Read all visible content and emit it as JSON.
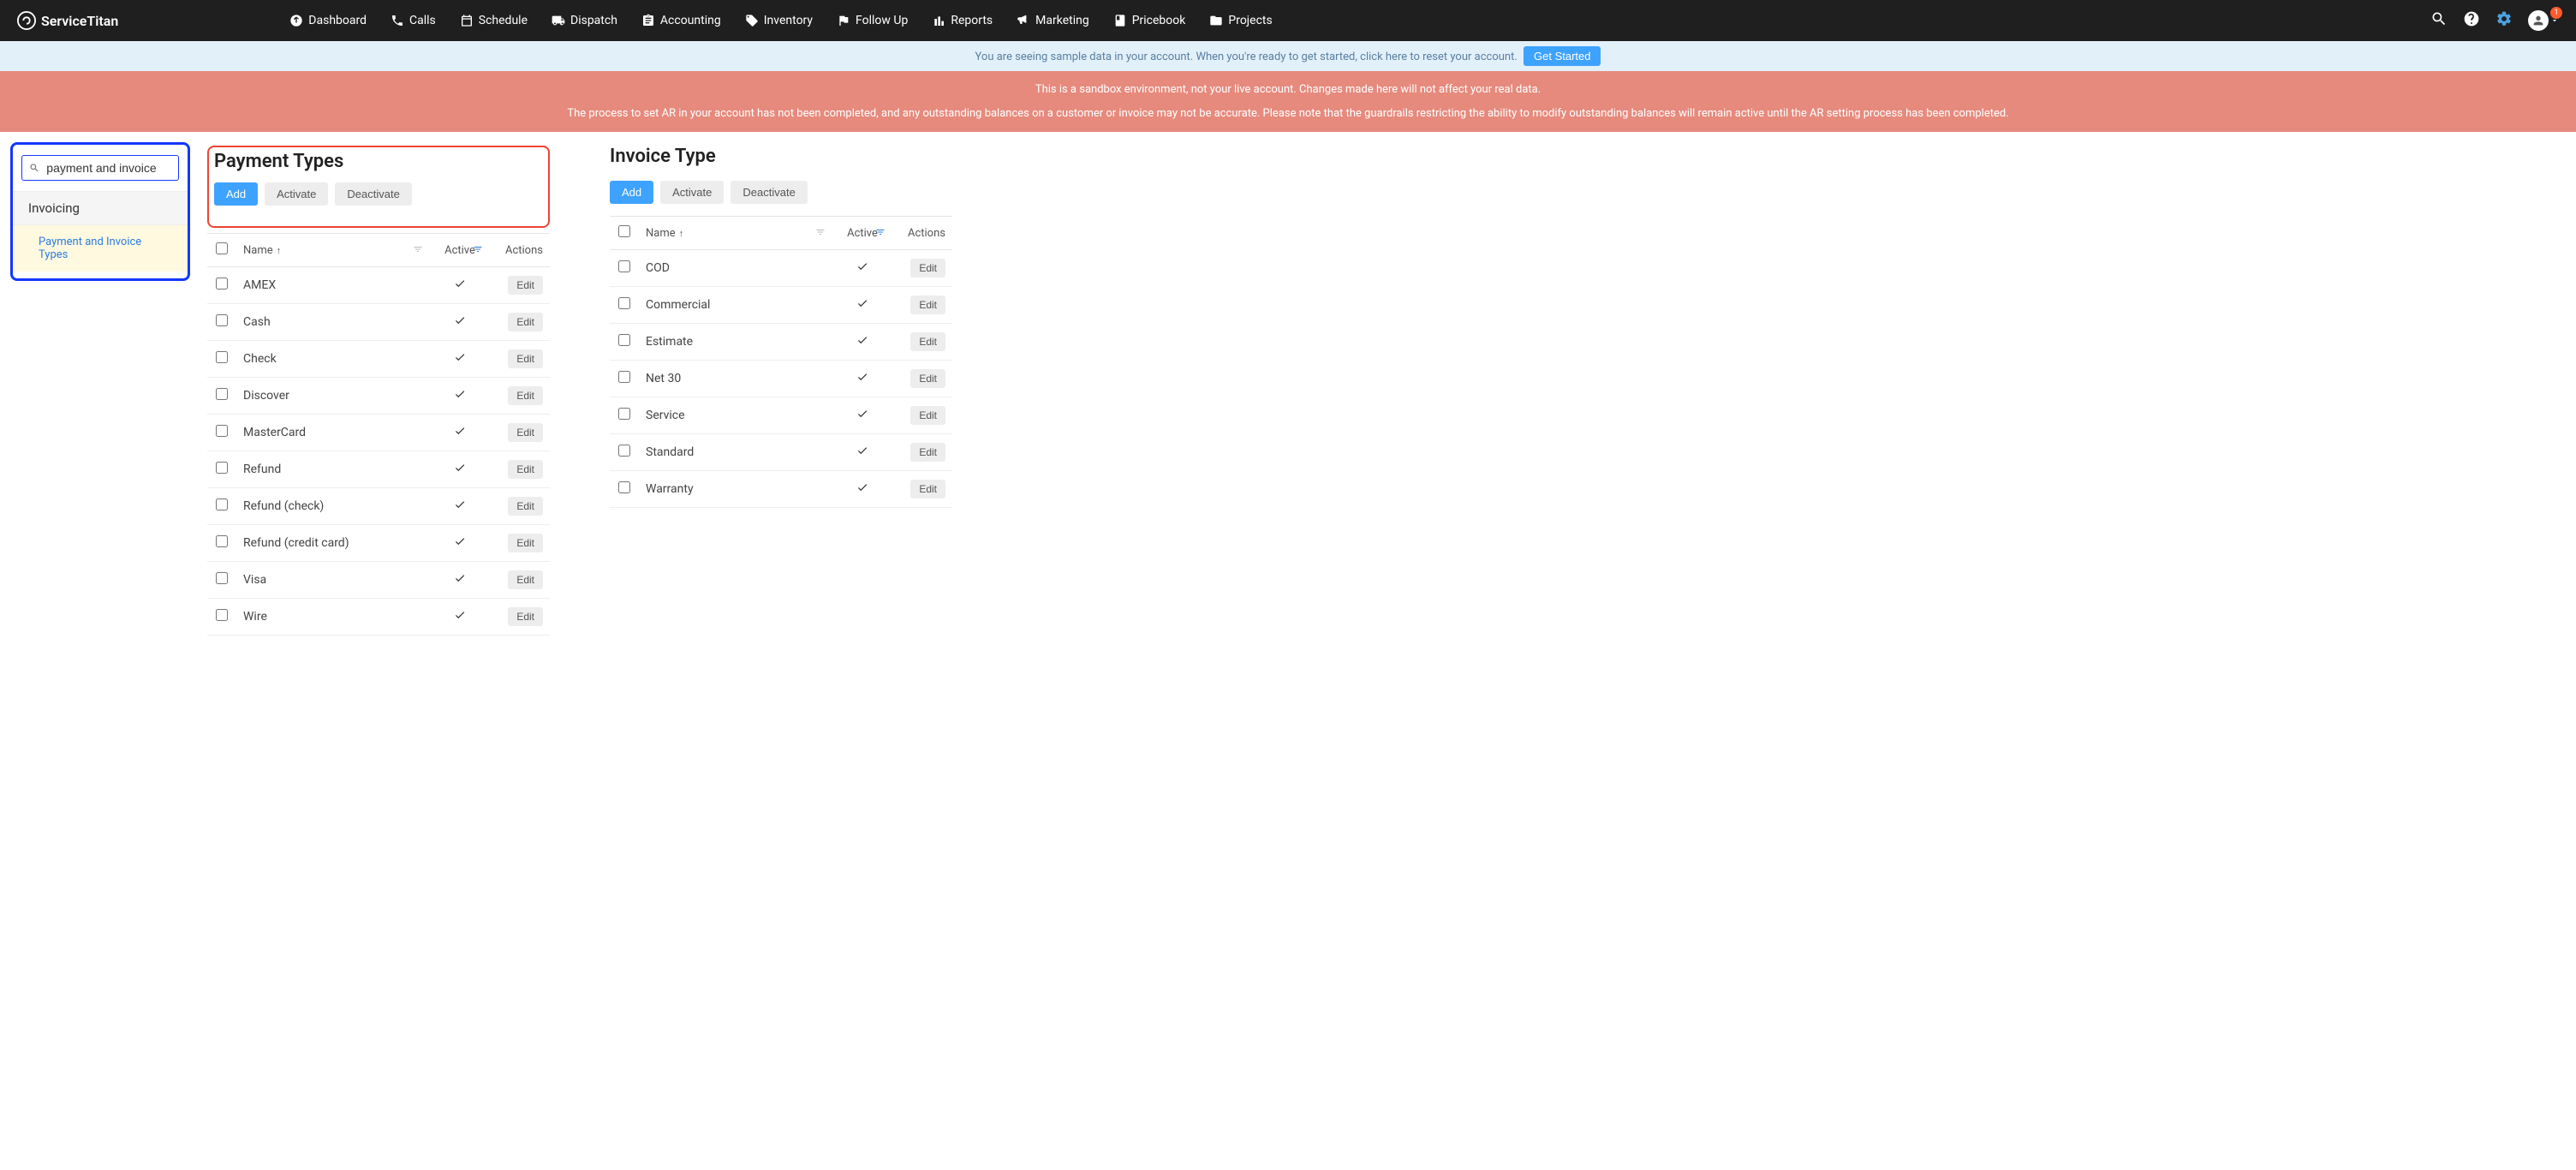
{
  "brand": "ServiceTitan",
  "nav": [
    {
      "label": "Dashboard",
      "icon": "dashboard"
    },
    {
      "label": "Calls",
      "icon": "phone"
    },
    {
      "label": "Schedule",
      "icon": "calendar"
    },
    {
      "label": "Dispatch",
      "icon": "truck"
    },
    {
      "label": "Accounting",
      "icon": "clipboard"
    },
    {
      "label": "Inventory",
      "icon": "tag"
    },
    {
      "label": "Follow Up",
      "icon": "flag"
    },
    {
      "label": "Reports",
      "icon": "bar"
    },
    {
      "label": "Marketing",
      "icon": "megaphone"
    },
    {
      "label": "Pricebook",
      "icon": "book"
    },
    {
      "label": "Projects",
      "icon": "folder"
    }
  ],
  "notification_count": "1",
  "banner_blue": {
    "text": "You are seeing sample data in your account. When you're ready to get started, click here to reset your account.",
    "button": "Get Started"
  },
  "banner_red": {
    "line1": "This is a sandbox environment, not your live account. Changes made here will not affect your real data.",
    "line2": "The process to set AR in your account has not been completed, and any outstanding balances on a customer or invoice may not be accurate. Please note that the guardrails restricting the ability to modify outstanding balances will remain active until the AR setting process has been completed."
  },
  "sidebar": {
    "search_value": "payment and invoice",
    "section": "Invoicing",
    "item": "Payment and Invoice Types"
  },
  "buttons": {
    "add": "Add",
    "activate": "Activate",
    "deactivate": "Deactivate",
    "edit": "Edit"
  },
  "table_headers": {
    "name": "Name",
    "active": "Active",
    "actions": "Actions"
  },
  "payment_types": {
    "title": "Payment Types",
    "rows": [
      {
        "name": "AMEX",
        "active": true
      },
      {
        "name": "Cash",
        "active": true
      },
      {
        "name": "Check",
        "active": true
      },
      {
        "name": "Discover",
        "active": true
      },
      {
        "name": "MasterCard",
        "active": true
      },
      {
        "name": "Refund",
        "active": true
      },
      {
        "name": "Refund (check)",
        "active": true
      },
      {
        "name": "Refund (credit card)",
        "active": true
      },
      {
        "name": "Visa",
        "active": true
      },
      {
        "name": "Wire",
        "active": true
      }
    ]
  },
  "invoice_type": {
    "title": "Invoice Type",
    "rows": [
      {
        "name": "COD",
        "active": true
      },
      {
        "name": "Commercial",
        "active": true
      },
      {
        "name": "Estimate",
        "active": true
      },
      {
        "name": "Net 30",
        "active": true
      },
      {
        "name": "Service",
        "active": true
      },
      {
        "name": "Standard",
        "active": true
      },
      {
        "name": "Warranty",
        "active": true
      }
    ]
  }
}
